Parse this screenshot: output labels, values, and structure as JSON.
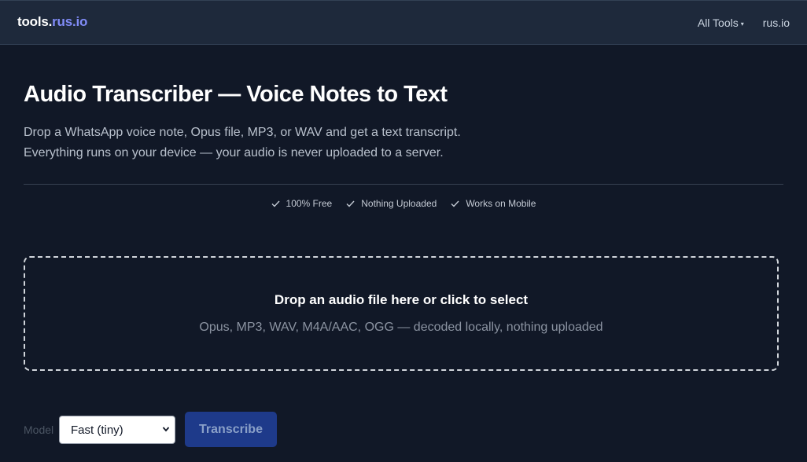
{
  "header": {
    "brand_prefix": "tools.",
    "brand_accent": "rus.io",
    "nav": [
      {
        "label": "All Tools",
        "has_caret": true
      },
      {
        "label": "rus.io",
        "has_caret": false
      }
    ]
  },
  "main": {
    "title": "Audio Transcriber — Voice Notes to Text",
    "description_line1": "Drop a WhatsApp voice note, Opus file, MP3, or WAV and get a text transcript.",
    "description_line2": "Everything runs on your device — your audio is never uploaded to a server.",
    "badges": [
      {
        "icon": "check-icon",
        "label": "100% Free"
      },
      {
        "icon": "check-icon",
        "label": "Nothing Uploaded"
      },
      {
        "icon": "check-icon",
        "label": "Works on Mobile"
      }
    ]
  },
  "dropzone": {
    "title": "Drop an audio file here or click to select",
    "subtitle": "Opus, MP3, WAV, M4A/AAC, OGG — decoded locally, nothing uploaded"
  },
  "controls": {
    "model_label": "Model",
    "model_selected": "Fast (tiny)",
    "transcribe_label": "Transcribe"
  },
  "colors": {
    "background": "#111827",
    "header_bg": "#1e293b",
    "brand_accent": "#818cf8",
    "button_bg": "#1e3a8a"
  }
}
